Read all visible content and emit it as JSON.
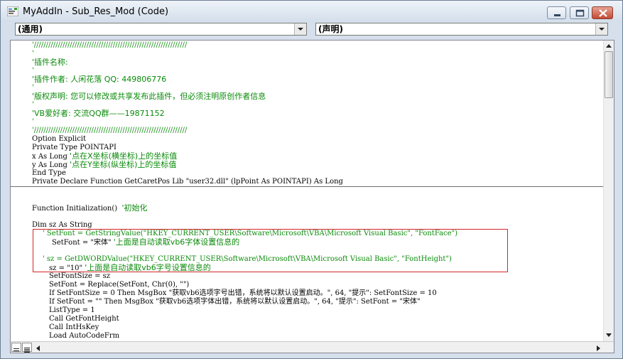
{
  "window": {
    "title": "MyAddIn - Sub_Res_Mod (Code)"
  },
  "toolbar": {
    "object_combo": "(通用)",
    "procedure_combo": "(声明)"
  },
  "code": {
    "header_lines": [
      "'////////////////////////////////////////////////////////////////",
      "'",
      "'插件名称:",
      "'",
      "'插件作者: 人闲花落 QQ: 449806776",
      "'",
      "'版权声明: 您可以修改或共享发布此插件，但必须注明原创作者信息",
      "'",
      "'VB爱好者: 交流QQ群——19871152",
      "'",
      "'////////////////////////////////////////////////////////////////"
    ],
    "decl_option": "Option Explicit",
    "decl_type": "Private Type POINTAPI",
    "decl_x": "x As Long",
    "decl_x_comment": "'点在X坐标(横坐标)上的坐标值",
    "decl_y": "y As Long",
    "decl_y_comment": "'点在Y坐标(纵坐标)上的坐标值",
    "decl_end": "End Type",
    "decl_declare": "Private Declare Function GetCaretPos Lib \"user32.dll\" (lpPoint As POINTAPI) As Long",
    "func_line": "Function Initialization()",
    "func_comment": "'初始化",
    "dim_line": "Dim sz As String",
    "hl_line1": "' SetFont = GetStringValue(\"HKEY_CURRENT_USER\\Software\\Microsoft\\VBA\\Microsoft Visual Basic\", \"FontFace\")",
    "hl_line2_code": "SetFont = \"宋体\"",
    "hl_line2_comment": "'上面是自动读取vb6字体设置信息的",
    "hl_line3": "' sz = GetDWORDValue(\"HKEY_CURRENT_USER\\Software\\Microsoft\\VBA\\Microsoft Visual Basic\", \"FontHeight\")",
    "hl_line4_code": "sz = \"10\"",
    "hl_line4_comment": "'上面是自动读取vb6字号设置信息的",
    "body_lines": [
      "SetFontSize = sz",
      "SetFont = Replace(SetFont, Chr(0), \"\")",
      "If SetFontSize = 0 Then MsgBox \"获取vb6选项字号出错，系统将以默认设置启动。\", 64, \"提示\": SetFontSize = 10",
      "If SetFont = \"\" Then MsgBox \"获取vb6选项字体出错，系统将以默认设置启动。\", 64, \"提示\": SetFont = \"宋体\"",
      "ListType = 1",
      "Call GetFontHeight",
      "Call IntHsKey",
      "Load AutoCodeFrm"
    ]
  }
}
